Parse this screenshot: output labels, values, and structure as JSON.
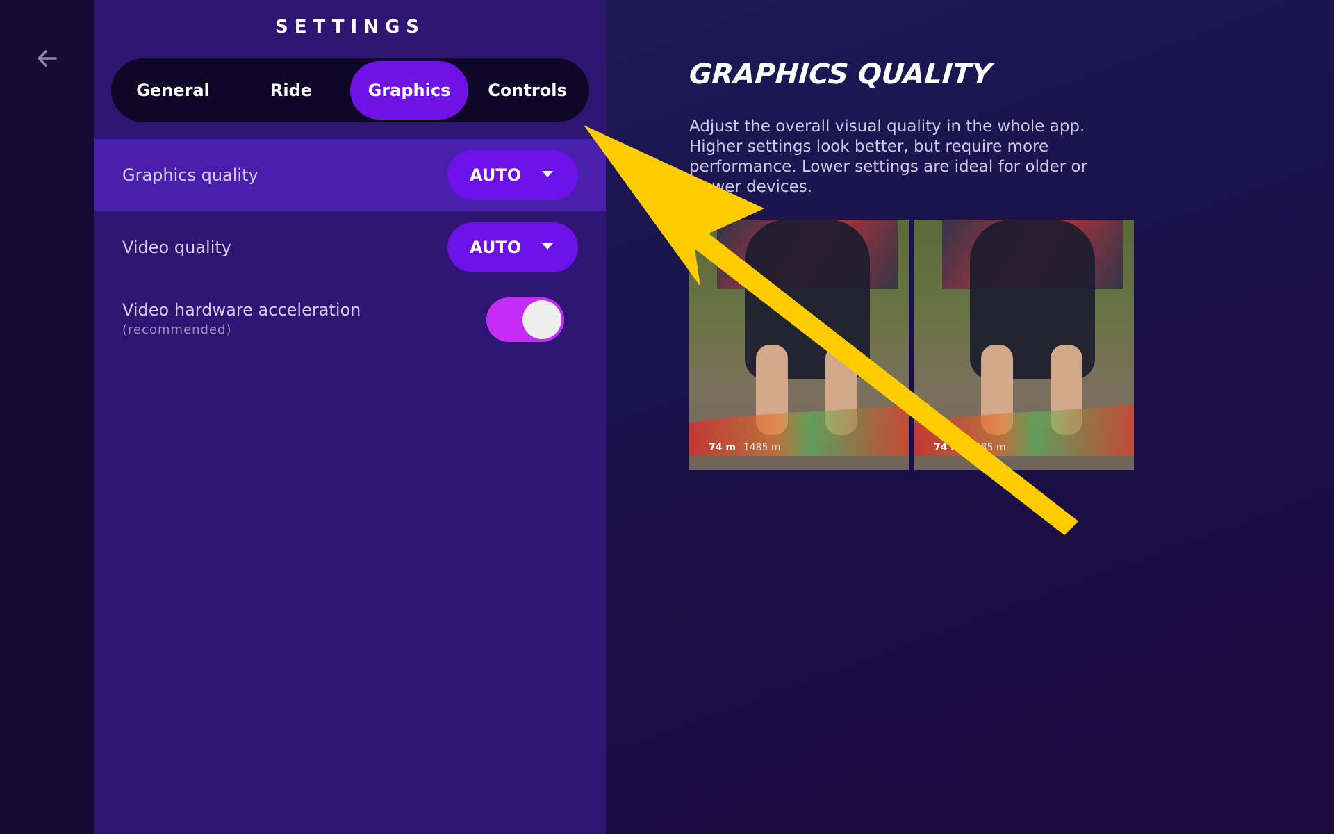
{
  "settings": {
    "title": "SETTINGS",
    "tabs": [
      {
        "label": "General",
        "active": false
      },
      {
        "label": "Ride",
        "active": false
      },
      {
        "label": "Graphics",
        "active": true
      },
      {
        "label": "Controls",
        "active": false
      }
    ],
    "rows": {
      "graphics_quality": {
        "label": "Graphics quality",
        "value": "AUTO"
      },
      "video_quality": {
        "label": "Video quality",
        "value": "AUTO"
      },
      "hw_accel": {
        "label": "Video hardware acceleration",
        "sublabel": "(recommended)",
        "enabled": true
      }
    }
  },
  "detail": {
    "title": "GRAPHICS QUALITY",
    "description": "Adjust the overall visual quality in the whole app. Higher settings look better, but require more performance. Lower settings are ideal for older or slower devices.",
    "previews": [
      {
        "distance": "74 m",
        "elevation": "1485 m"
      },
      {
        "distance": "74 m",
        "elevation": "1485 m"
      }
    ]
  },
  "colors": {
    "accent": "#6e12e6",
    "panel": "#2f1573",
    "toggle_on": "#c52cf5",
    "annotation_arrow": "#ffcc00"
  },
  "icons": {
    "back": "arrow-left-icon",
    "dropdown": "caret-down-icon"
  }
}
